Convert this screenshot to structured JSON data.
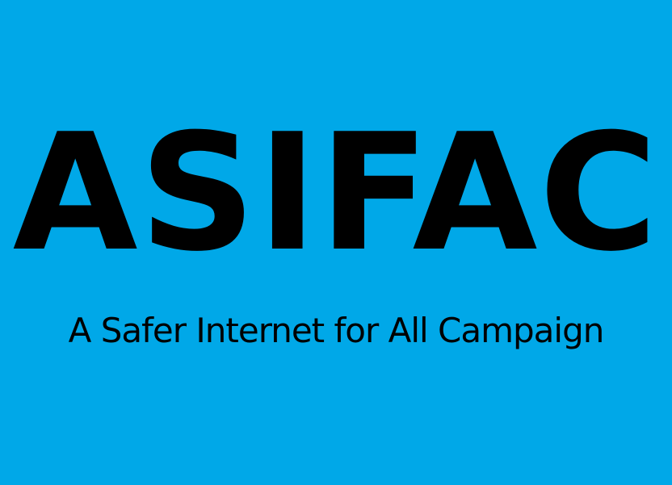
{
  "logo": {
    "title": "ASIFAC",
    "subtitle": "A Safer Internet for All Campaign"
  },
  "colors": {
    "background": "#00a8e8",
    "text": "#000000"
  }
}
